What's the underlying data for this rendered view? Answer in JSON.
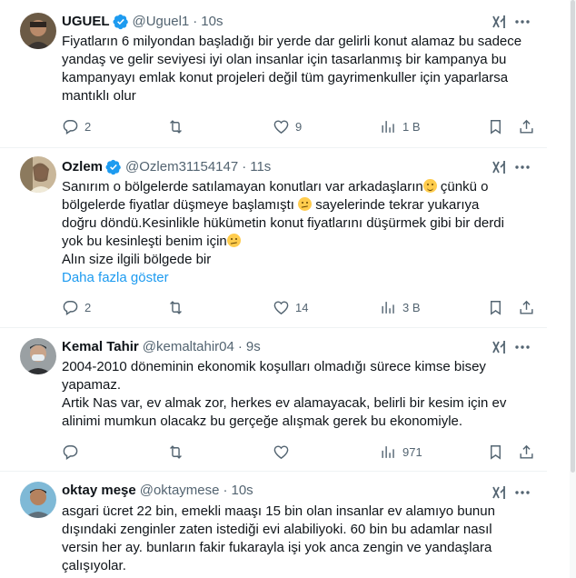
{
  "tweets": [
    {
      "name": "UGUEL",
      "handle": "@Uguel1",
      "time": "10s",
      "lines": [
        "Fiyatların 6 milyondan başladığı bir yerde dar gelirli konut alamaz bu sadece",
        "yandaş ve gelir seviyesi iyi olan insanlar için tasarlanmış bir kampanya bu",
        "kampanyayı emlak konut projeleri değil tüm gayrimenkuller için yaparlarsa",
        "mantıklı olur"
      ],
      "replies": "2",
      "retweets": "",
      "likes": "9",
      "views": "1 B"
    },
    {
      "name": "Ozlem",
      "handle": "@Ozlem31154147",
      "time": "11s",
      "lines": [
        "Sanırım  o bölgelerde satılamayan konutları var arkadaşların",
        " çünkü o",
        "bölgelerde fiyatlar düşmeye başlamıştı ",
        " sayelerinde tekrar yukarıya",
        "doğru döndü.Kesinlikle hükümetin konut fiyatlarını düşürmek gibi bir derdi",
        "yok bu kesinleşti benim için",
        "Alın size ilgili bölgede bir"
      ],
      "show_more": "Daha fazla göster",
      "replies": "2",
      "retweets": "",
      "likes": "14",
      "views": "3 B"
    },
    {
      "name": "Kemal Tahir",
      "handle": "@kemaltahir04",
      "time": "9s",
      "lines": [
        "2004-2010 döneminin ekonomik koşulları olmadığı sürece kimse bisey",
        "yapamaz.",
        "Artik Nas var, ev almak zor, herkes ev alamayacak, belirli bir kesim için ev",
        "alinimi mumkun olacakz bu gerçeğe alışmak gerek bu ekonomiyle."
      ],
      "replies": "",
      "retweets": "",
      "likes": "",
      "views": "971"
    },
    {
      "name": "oktay meşe",
      "handle": "@oktaymese",
      "time": "10s",
      "lines": [
        "asgari ücret 22 bin, emekli maaşı 15 bin olan insanlar ev alamıyo bunun",
        "dışındaki zenginler zaten istediği evi alabiliyoki. 60 bin bu adamlar nasıl",
        "versin her ay. bunların fakir fukarayla işi yok anca zengin ve yandaşlara",
        "çalışıyolar."
      ]
    }
  ],
  "colors": {
    "accent": "#1d9bf0",
    "muted": "#536471",
    "text": "#0f1419"
  },
  "icons": [
    "verified-badge-icon",
    "grok-icon",
    "more-icon",
    "reply-icon",
    "retweet-icon",
    "like-icon",
    "views-icon",
    "bookmark-icon",
    "share-icon"
  ]
}
